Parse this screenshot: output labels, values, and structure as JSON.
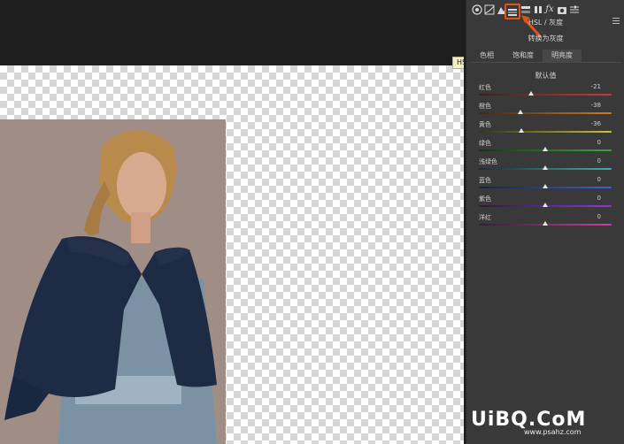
{
  "tooltip": "HSL / 灰度",
  "panel": {
    "title": "HSL / 灰度",
    "convert_gray": "转换为灰度",
    "tabs": [
      "色相",
      "饱和度",
      "明亮度"
    ],
    "active_tab_index": 2,
    "default_label": "默认值",
    "sliders": [
      {
        "label": "红色",
        "value": "-21",
        "fraction": 0.395,
        "track": "linear-gradient(to right,#3a2020,#cc3a3a)"
      },
      {
        "label": "橙色",
        "value": "-38",
        "fraction": 0.31,
        "track": "linear-gradient(to right,#3a2a18,#d07a2a)"
      },
      {
        "label": "黄色",
        "value": "-36",
        "fraction": 0.32,
        "track": "linear-gradient(to right,#35341a,#c9c23a)"
      },
      {
        "label": "绿色",
        "value": "0",
        "fraction": 0.5,
        "track": "linear-gradient(to right,#1c301c,#3aa83a)"
      },
      {
        "label": "浅绿色",
        "value": "0",
        "fraction": 0.5,
        "track": "linear-gradient(to right,#1a2f30,#35b0b4)"
      },
      {
        "label": "蓝色",
        "value": "0",
        "fraction": 0.5,
        "track": "linear-gradient(to right,#1a2236,#3a64d0)"
      },
      {
        "label": "紫色",
        "value": "0",
        "fraction": 0.5,
        "track": "linear-gradient(to right,#2a1c36,#8a3ad0)"
      },
      {
        "label": "洋红",
        "value": "0",
        "fraction": 0.5,
        "track": "linear-gradient(to right,#361c30,#d03ab0)"
      }
    ]
  },
  "watermark": {
    "brand": "UiBQ.CoM",
    "url": "www.psahz.com"
  },
  "colors": {
    "accent": "#e0531c",
    "panel_bg": "#393939"
  }
}
